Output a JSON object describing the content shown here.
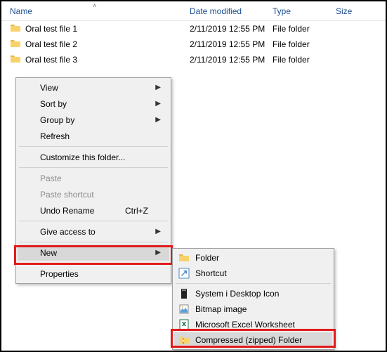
{
  "columns": {
    "name": "Name",
    "date": "Date modified",
    "type": "Type",
    "size": "Size"
  },
  "files": [
    {
      "name": "Oral test file 1",
      "date": "2/11/2019 12:55 PM",
      "type": "File folder"
    },
    {
      "name": "Oral test file 2",
      "date": "2/11/2019 12:55 PM",
      "type": "File folder"
    },
    {
      "name": "Oral test file 3",
      "date": "2/11/2019 12:55 PM",
      "type": "File folder"
    }
  ],
  "menu": {
    "view": "View",
    "sort": "Sort by",
    "group": "Group by",
    "refresh": "Refresh",
    "customize": "Customize this folder...",
    "paste": "Paste",
    "paste_shortcut": "Paste shortcut",
    "undo": "Undo Rename",
    "undo_key": "Ctrl+Z",
    "give_access": "Give access to",
    "new": "New",
    "properties": "Properties"
  },
  "submenu": {
    "folder": "Folder",
    "shortcut": "Shortcut",
    "systemi": "System i Desktop Icon",
    "bitmap": "Bitmap image",
    "excel": "Microsoft Excel Worksheet",
    "zip": "Compressed (zipped) Folder"
  }
}
